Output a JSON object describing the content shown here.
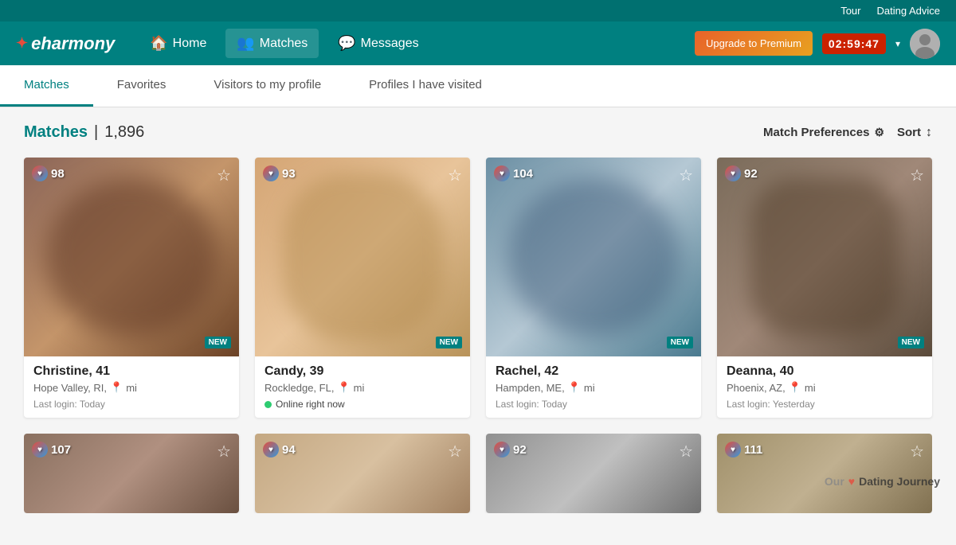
{
  "topBar": {
    "links": [
      "Tour",
      "Dating Advice"
    ],
    "upgradeBtn": "Upgrade to Premium",
    "countdown": "02:59:47"
  },
  "logo": {
    "text": "eharmony",
    "heartSymbol": "♥"
  },
  "nav": {
    "items": [
      {
        "id": "home",
        "label": "Home",
        "icon": "🏠",
        "active": false
      },
      {
        "id": "matches",
        "label": "Matches",
        "icon": "👥",
        "active": true
      },
      {
        "id": "messages",
        "label": "Messages",
        "icon": "💬",
        "active": false
      }
    ]
  },
  "tabs": [
    {
      "id": "matches",
      "label": "Matches",
      "active": true
    },
    {
      "id": "favorites",
      "label": "Favorites",
      "active": false
    },
    {
      "id": "visitors",
      "label": "Visitors to my profile",
      "active": false
    },
    {
      "id": "visited",
      "label": "Profiles I have visited",
      "active": false
    }
  ],
  "matchesSection": {
    "titleLabel": "Matches",
    "separator": "|",
    "count": "1,896",
    "matchPrefsLabel": "Match Preferences",
    "matchPrefsIcon": "⚙",
    "sortLabel": "Sort",
    "sortIcon": "↕"
  },
  "profiles": [
    {
      "name": "Christine, 41",
      "location": "Hope Valley, RI,",
      "distanceLabel": "mi",
      "score": 98,
      "loginStatus": "Last login: Today",
      "isOnline": false,
      "isNew": true,
      "bgClass": "bg-warm-brown"
    },
    {
      "name": "Candy, 39",
      "location": "Rockledge, FL,",
      "distanceLabel": "mi",
      "score": 93,
      "loginStatus": "Online right now",
      "isOnline": true,
      "isNew": true,
      "bgClass": "bg-warm-blonde"
    },
    {
      "name": "Rachel, 42",
      "location": "Hampden, ME,",
      "distanceLabel": "mi",
      "score": 104,
      "loginStatus": "Last login: Today",
      "isOnline": false,
      "isNew": true,
      "bgClass": "bg-cool-blue"
    },
    {
      "name": "Deanna, 40",
      "location": "Phoenix, AZ,",
      "distanceLabel": "mi",
      "score": 92,
      "loginStatus": "Last login: Yesterday",
      "isOnline": false,
      "isNew": true,
      "bgClass": "bg-warm-dark"
    }
  ],
  "profiles2": [
    {
      "score": 107,
      "bgClass": "bg-row2-1"
    },
    {
      "score": 94,
      "bgClass": "bg-row2-2"
    },
    {
      "score": 92,
      "bgClass": "bg-row2-3"
    },
    {
      "score": 111,
      "bgClass": "bg-row2-4"
    }
  ],
  "watermark": {
    "heart": "♥",
    "text": "Dating Journey"
  }
}
